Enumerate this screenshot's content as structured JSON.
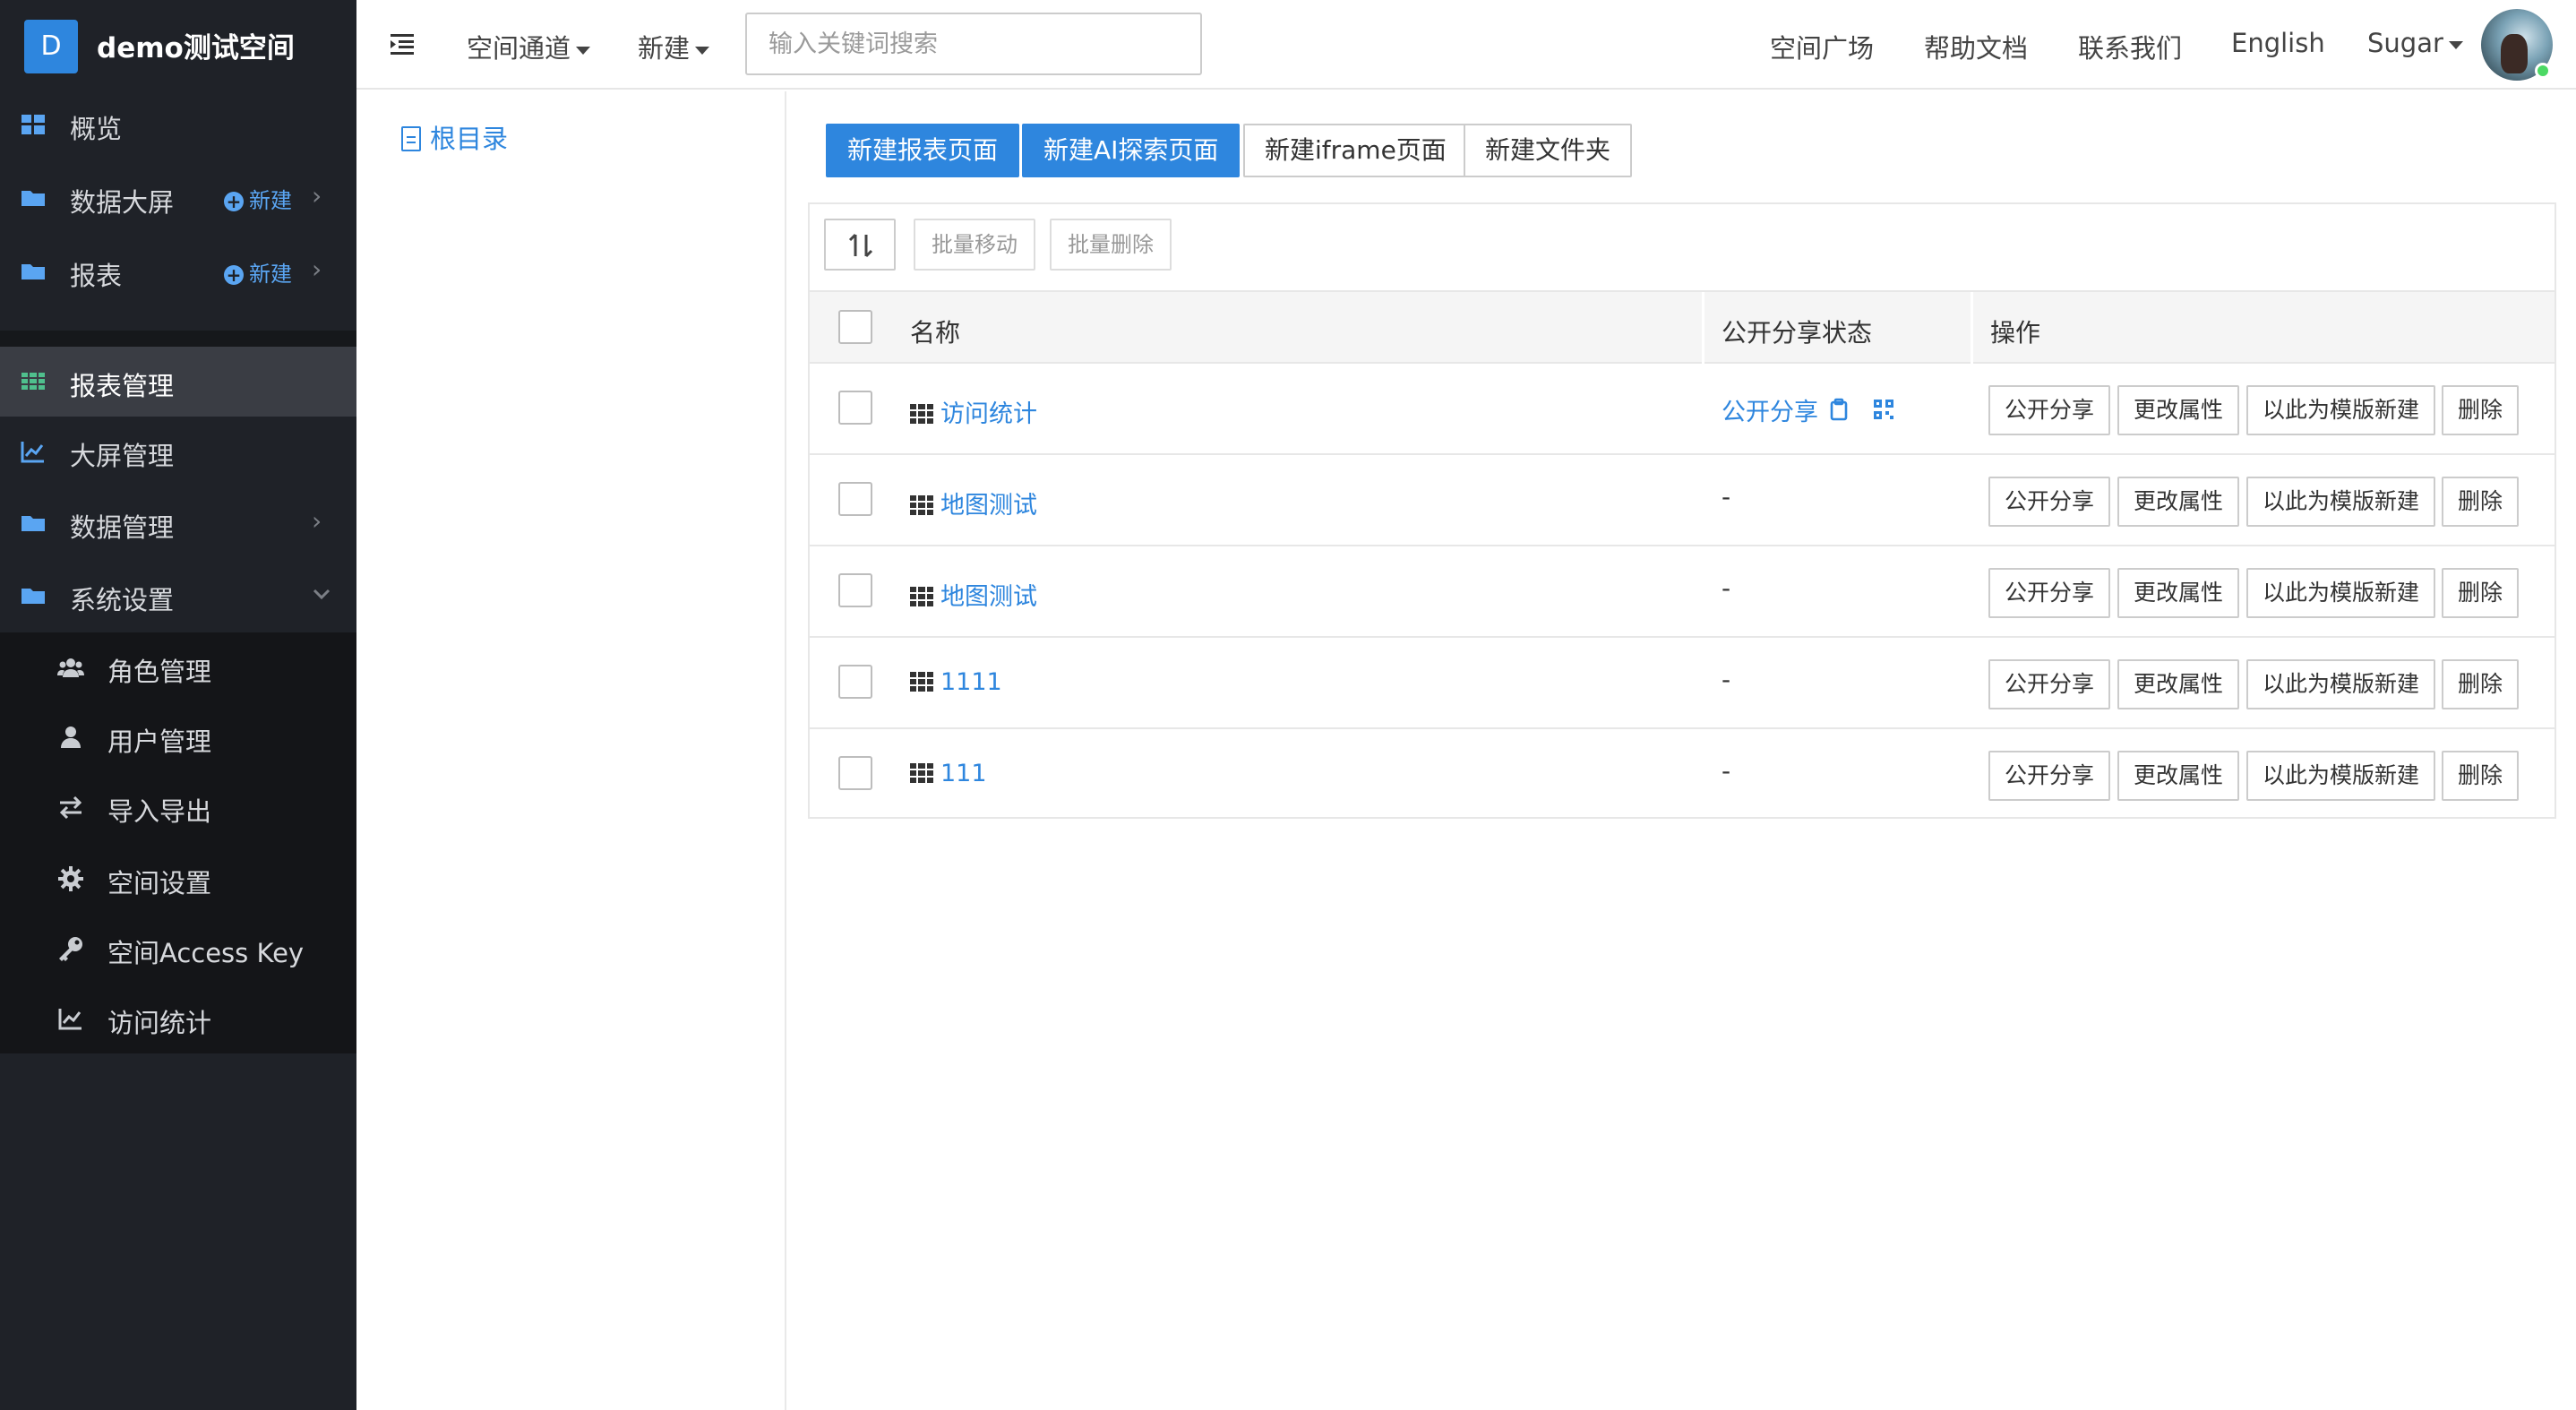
{
  "app": {
    "badge": "D",
    "title": "demo测试空间"
  },
  "sidebar": {
    "items": [
      {
        "label": "概览",
        "icon": "dashboard-icon"
      },
      {
        "label": "数据大屏",
        "icon": "folder-icon",
        "new_label": "新建"
      },
      {
        "label": "报表",
        "icon": "folder-icon",
        "new_label": "新建"
      },
      {
        "label": "报表管理",
        "icon": "grid-icon",
        "active": true
      },
      {
        "label": "大屏管理",
        "icon": "line-chart-icon"
      },
      {
        "label": "数据管理",
        "icon": "folder-icon"
      },
      {
        "label": "系统设置",
        "icon": "folder-icon"
      }
    ],
    "sub_items": [
      {
        "label": "角色管理",
        "icon": "users-icon"
      },
      {
        "label": "用户管理",
        "icon": "user-icon"
      },
      {
        "label": "导入导出",
        "icon": "exchange-icon"
      },
      {
        "label": "空间设置",
        "icon": "gear-icon"
      },
      {
        "label": "空间Access Key",
        "icon": "key-icon"
      },
      {
        "label": "访问统计",
        "icon": "line-chart-icon"
      }
    ]
  },
  "header": {
    "channel": "空间通道",
    "new": "新建",
    "search_placeholder": "输入关键词搜索",
    "links": [
      "空间广场",
      "帮助文档",
      "联系我们",
      "English"
    ],
    "user": "Sugar"
  },
  "directory": {
    "root": "根目录"
  },
  "toolbar": {
    "new_report": "新建报表页面",
    "new_ai": "新建AI探索页面",
    "new_iframe": "新建iframe页面",
    "new_folder": "新建文件夹"
  },
  "table": {
    "batch_move": "批量移动",
    "batch_delete": "批量删除",
    "headers": {
      "name": "名称",
      "share": "公开分享状态",
      "ops": "操作"
    },
    "rows": [
      {
        "name": "访问统计",
        "share": "公开分享"
      },
      {
        "name": "地图测试",
        "share": "-"
      },
      {
        "name": "地图测试",
        "share": "-"
      },
      {
        "name": "1111",
        "share": "-"
      },
      {
        "name": "111",
        "share": "-"
      }
    ],
    "actions": {
      "share": "公开分享",
      "props": "更改属性",
      "template": "以此为模版新建",
      "delete": "删除"
    }
  },
  "colors": {
    "accent": "#2e86de",
    "sidebar": "#1f2228",
    "online": "#4cd964"
  }
}
